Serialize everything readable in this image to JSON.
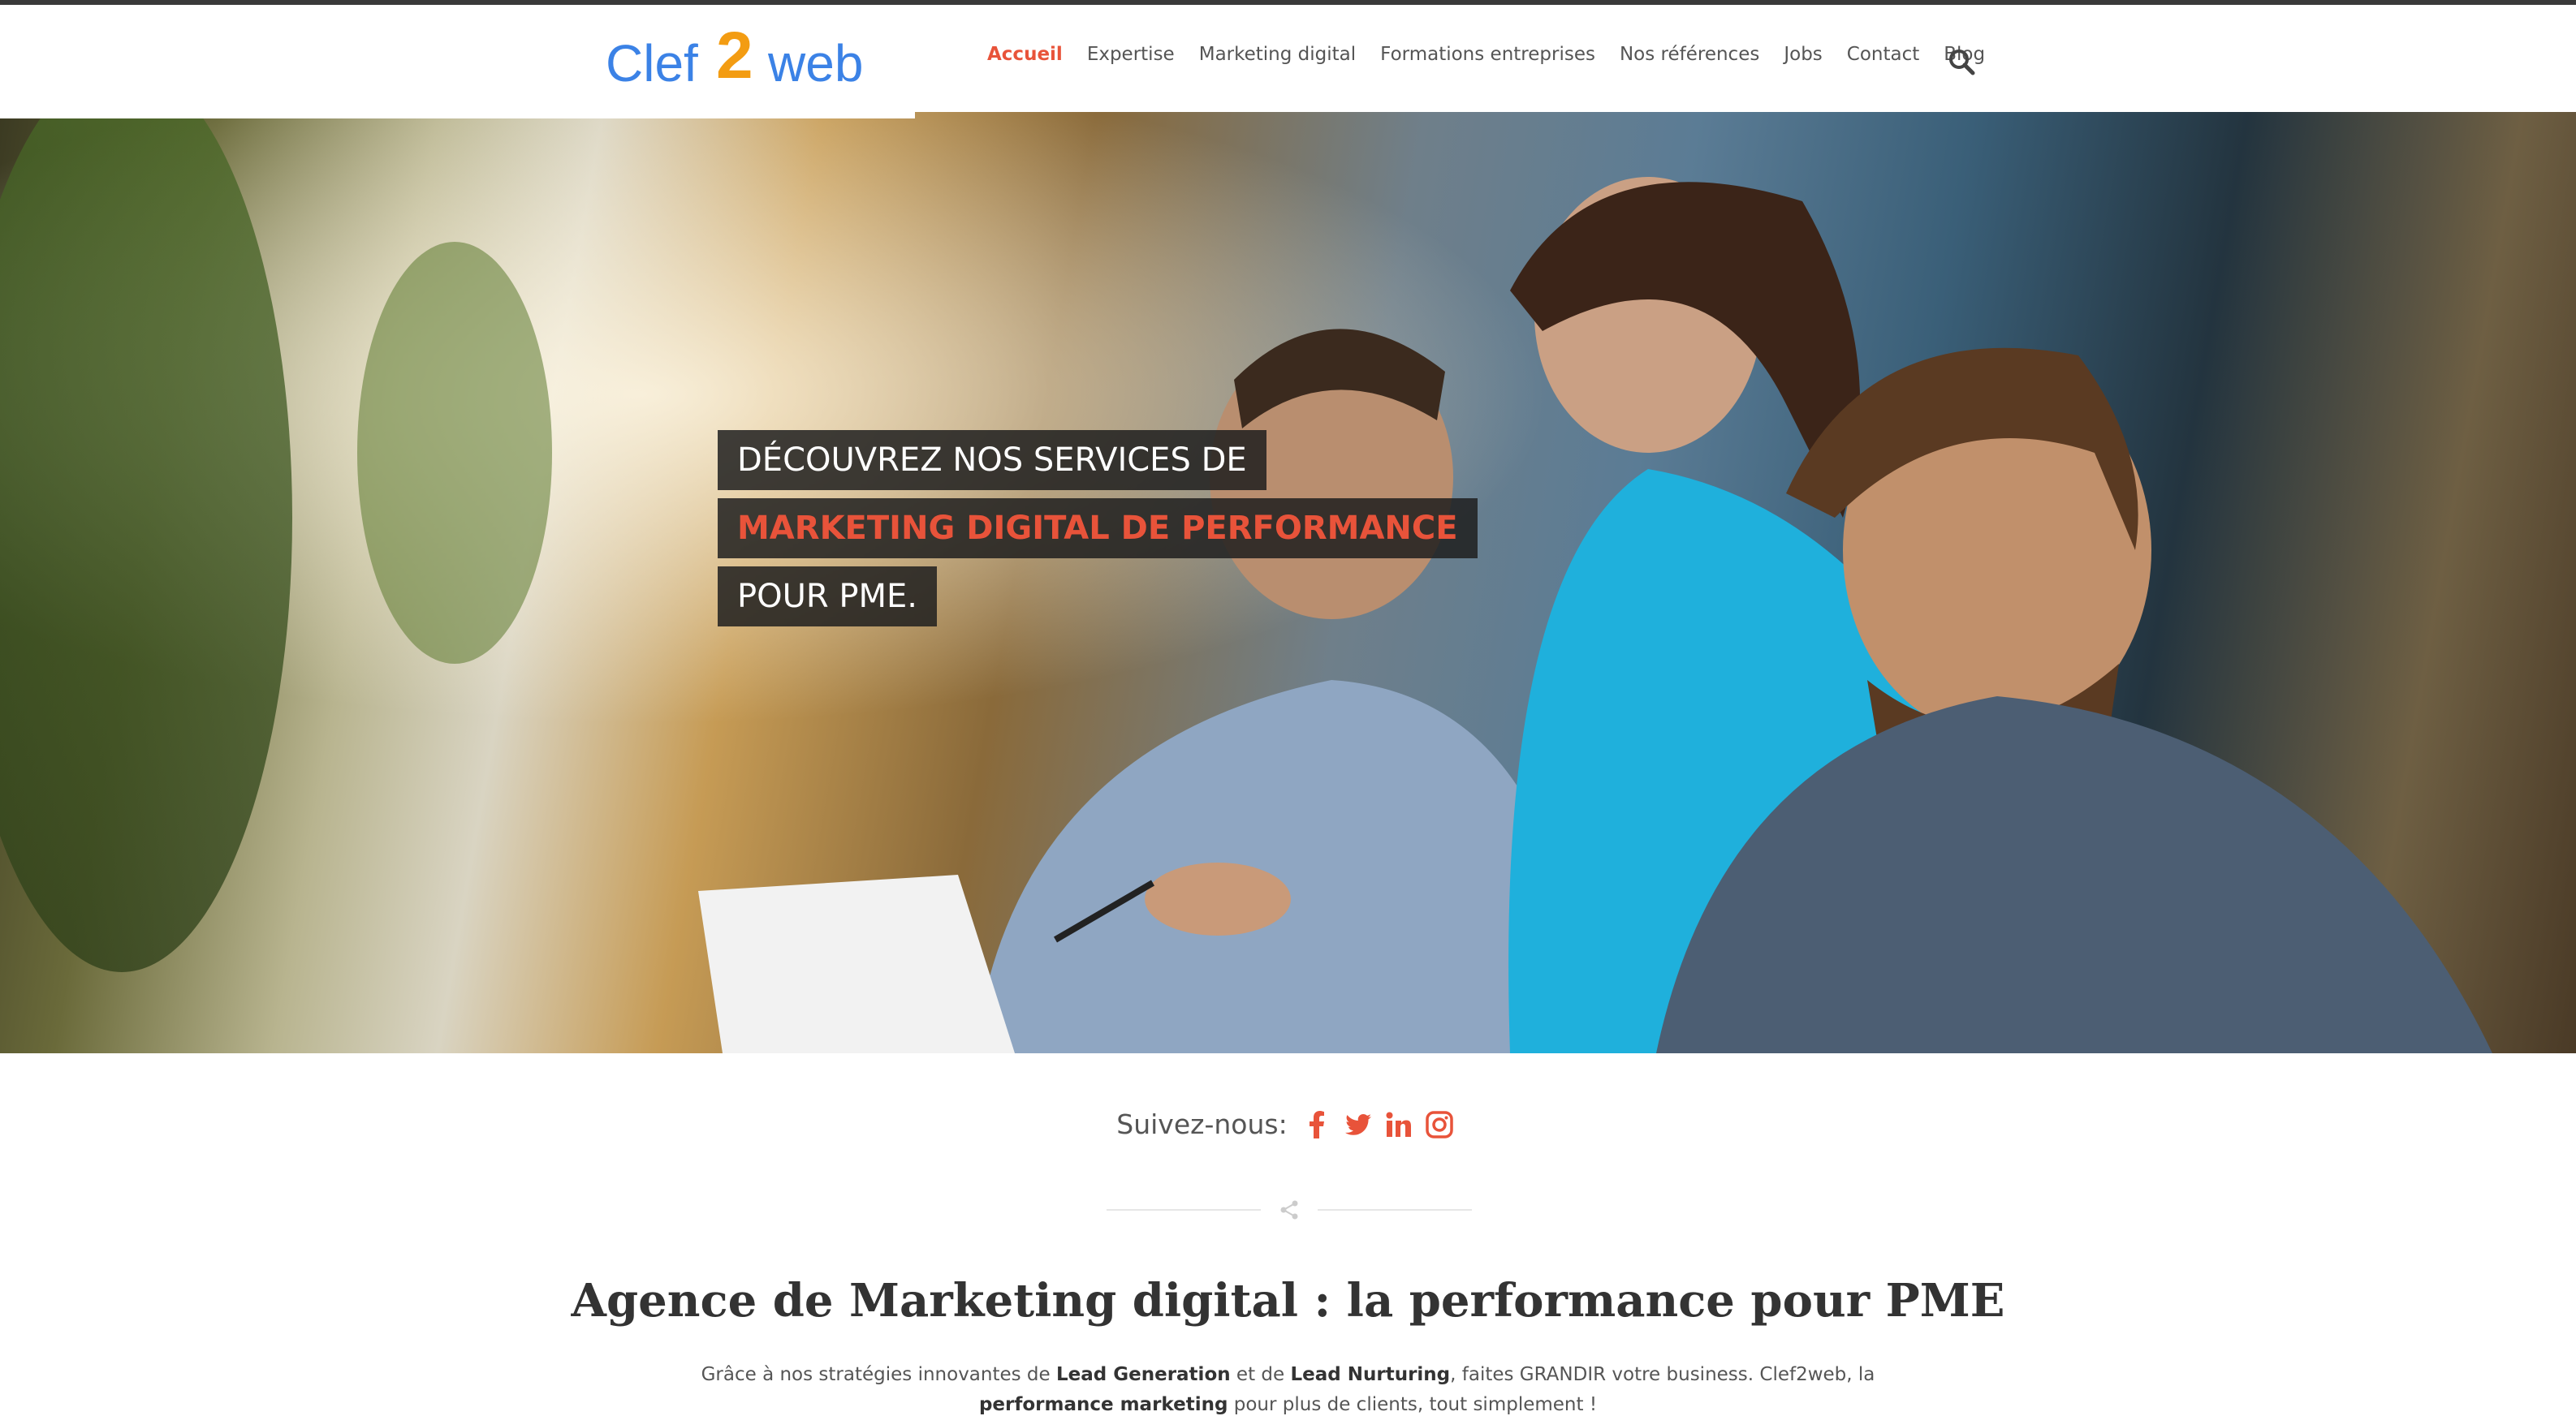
{
  "logo": {
    "part1": "Clef",
    "part2": "2",
    "part3": "web"
  },
  "nav": {
    "items": [
      {
        "label": "Accueil",
        "active": true
      },
      {
        "label": "Expertise",
        "active": false
      },
      {
        "label": "Marketing digital",
        "active": false
      },
      {
        "label": "Formations entreprises",
        "active": false
      },
      {
        "label": "Nos références",
        "active": false
      },
      {
        "label": "Jobs",
        "active": false
      },
      {
        "label": "Contact",
        "active": false
      },
      {
        "label": "Blog",
        "active": false
      }
    ],
    "search_icon": "search-icon"
  },
  "hero": {
    "line1": "DÉCOUVREZ NOS SERVICES DE",
    "line2": "MARKETING DIGITAL DE PERFORMANCE",
    "line3": "POUR PME."
  },
  "social": {
    "label": "Suivez-nous:",
    "icons": [
      "facebook-icon",
      "twitter-icon",
      "linkedin-icon",
      "instagram-icon"
    ]
  },
  "divider": {
    "icon": "share-icon"
  },
  "section": {
    "title_pre": "Agence de ",
    "title_bold": "Marketing digital",
    "title_post": " : la performance pour PME",
    "text_1": "Grâce à nos stratégies innovantes de ",
    "text_b1": "Lead Generation",
    "text_2": " et de ",
    "text_b2": "Lead Nurturing",
    "text_3": ", faites GRANDIR votre business. Clef2web, la ",
    "text_b3": "performance marketing",
    "text_4": " pour plus de clients, tout simplement !"
  },
  "colors": {
    "accent": "#e8533a",
    "logo_blue": "#3b82e6",
    "logo_orange": "#f39c12",
    "dark": "#3a3a3a"
  }
}
